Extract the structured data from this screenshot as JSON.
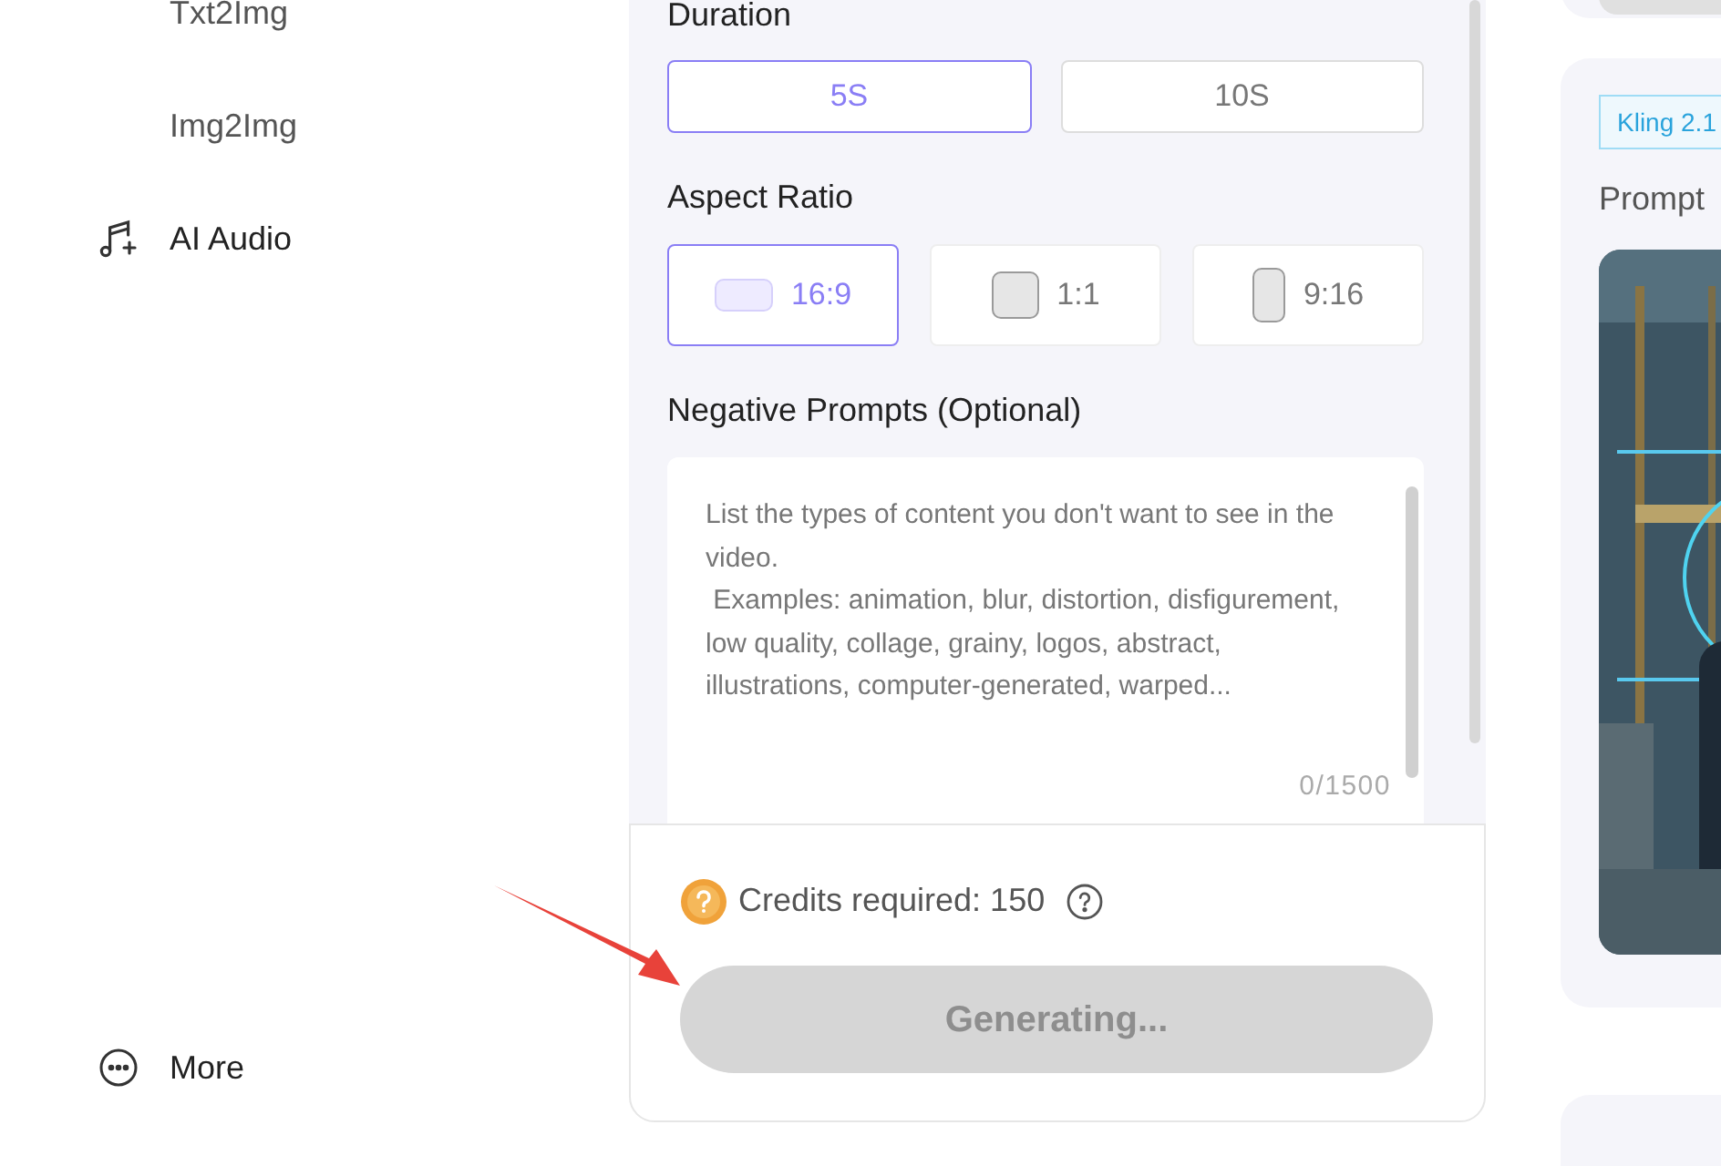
{
  "sidebar": {
    "items": [
      {
        "label": "Txt2Img",
        "kind": "sub"
      },
      {
        "label": "Img2Img",
        "kind": "sub"
      },
      {
        "label": "AI Audio",
        "kind": "audio"
      },
      {
        "label": "More",
        "kind": "more"
      }
    ]
  },
  "settings": {
    "duration": {
      "label": "Duration",
      "options": [
        {
          "label": "5S",
          "selected": true
        },
        {
          "label": "10S",
          "selected": false
        }
      ]
    },
    "aspect_ratio": {
      "label": "Aspect Ratio",
      "options": [
        {
          "label": "16:9",
          "kind": "wide",
          "selected": true
        },
        {
          "label": "1:1",
          "kind": "square",
          "selected": false
        },
        {
          "label": "9:16",
          "kind": "tall",
          "selected": false
        }
      ]
    },
    "negative_prompts": {
      "label": "Negative Prompts (Optional)",
      "placeholder": "List the types of content you don't want to see in the video.\n Examples: animation, blur, distortion, disfigurement, low quality, collage, grainy, logos, abstract, illustrations, computer-generated, warped...",
      "counter": "0/1500"
    }
  },
  "footer": {
    "credits": "Credits required: 150",
    "button": {
      "label": "Generating...",
      "disabled": true
    }
  },
  "gallery": {
    "card": {
      "badge": "Kling 2.1",
      "prompt": "Prompt"
    }
  }
}
